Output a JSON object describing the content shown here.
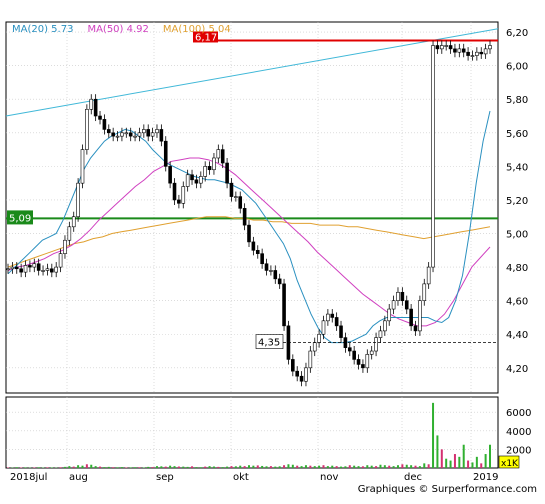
{
  "chart_data": {
    "type": "candlestick",
    "ylim": [
      4.05,
      6.26
    ],
    "y_ticks": [
      "6,20",
      "6,00",
      "5,80",
      "5,60",
      "5,40",
      "5,20",
      "5,00",
      "4,80",
      "4,60",
      "4,40",
      "4,20"
    ],
    "volume_ticks": [
      "6000",
      "4000",
      "2000"
    ],
    "volume_unit": "x1K",
    "x_labels": [
      "2018jul",
      "aug",
      "sep",
      "okt",
      "nov",
      "dec",
      "2019"
    ],
    "legend": [
      {
        "label": "MA(20)",
        "value": "5.73",
        "color": "#2a90c0"
      },
      {
        "label": "MA(50)",
        "value": "4.92",
        "color": "#d040c0"
      },
      {
        "label": "MA(100)",
        "value": "5.04",
        "color": "#e0a030"
      }
    ],
    "resistance": {
      "value": 6.15,
      "label": "6,17",
      "color": "#e00000"
    },
    "support": {
      "value": 5.09,
      "label": "5,09",
      "color": "#1a8a1a"
    },
    "low_marker": {
      "value": 4.35,
      "label": "4,35"
    },
    "trend_line": {
      "color": "#40b8d8",
      "from": 5.7,
      "to": 6.22
    },
    "close": [
      4.79,
      4.8,
      4.79,
      4.77,
      4.81,
      4.8,
      4.82,
      4.78,
      4.78,
      4.79,
      4.77,
      4.8,
      4.88,
      4.96,
      5.04,
      5.1,
      5.3,
      5.5,
      5.74,
      5.8,
      5.7,
      5.68,
      5.62,
      5.6,
      5.58,
      5.58,
      5.6,
      5.6,
      5.58,
      5.58,
      5.6,
      5.62,
      5.58,
      5.6,
      5.62,
      5.55,
      5.4,
      5.3,
      5.2,
      5.18,
      5.28,
      5.35,
      5.32,
      5.3,
      5.34,
      5.4,
      5.38,
      5.45,
      5.5,
      5.42,
      5.3,
      5.22,
      5.22,
      5.15,
      5.05,
      4.95,
      4.9,
      4.88,
      4.82,
      4.78,
      4.78,
      4.73,
      4.7,
      4.45,
      4.25,
      4.18,
      4.15,
      4.12,
      4.2,
      4.3,
      4.35,
      4.4,
      4.48,
      4.52,
      4.5,
      4.45,
      4.38,
      4.32,
      4.3,
      4.25,
      4.22,
      4.2,
      4.28,
      4.3,
      4.38,
      4.42,
      4.48,
      4.55,
      4.6,
      4.65,
      4.6,
      4.55,
      4.45,
      4.42,
      4.6,
      4.7,
      4.8,
      6.12,
      6.1,
      6.12,
      6.12,
      6.1,
      6.08,
      6.1,
      6.08,
      6.06,
      6.06,
      6.08,
      6.07,
      6.1,
      6.12
    ],
    "ma20": [
      4.76,
      4.8,
      4.84,
      4.88,
      4.92,
      4.96,
      4.98,
      5.0,
      5.08,
      5.18,
      5.28,
      5.38,
      5.45,
      5.5,
      5.55,
      5.58,
      5.6,
      5.62,
      5.61,
      5.58,
      5.55,
      5.5,
      5.46,
      5.42,
      5.4,
      5.38,
      5.36,
      5.34,
      5.33,
      5.32,
      5.32,
      5.31,
      5.3,
      5.28,
      5.26,
      5.22,
      5.18,
      5.12,
      5.06,
      5.0,
      4.94,
      4.85,
      4.72,
      4.62,
      4.52,
      4.44,
      4.38,
      4.35,
      4.35,
      4.35,
      4.36,
      4.38,
      4.4,
      4.45,
      4.48,
      4.5,
      4.5,
      4.5,
      4.5,
      4.5,
      4.5,
      4.5,
      4.48,
      4.47,
      4.5,
      4.6,
      4.75,
      5.0,
      5.3,
      5.55,
      5.73
    ],
    "ma50": [
      4.78,
      4.8,
      4.81,
      4.83,
      4.85,
      4.88,
      4.9,
      4.93,
      4.97,
      5.02,
      5.08,
      5.13,
      5.18,
      5.23,
      5.28,
      5.32,
      5.37,
      5.4,
      5.43,
      5.44,
      5.45,
      5.45,
      5.44,
      5.42,
      5.39,
      5.35,
      5.3,
      5.25,
      5.2,
      5.15,
      5.1,
      5.05,
      5.0,
      4.95,
      4.89,
      4.84,
      4.79,
      4.74,
      4.69,
      4.64,
      4.6,
      4.56,
      4.52,
      4.49,
      4.47,
      4.45,
      4.45,
      4.47,
      4.52,
      4.6,
      4.7,
      4.8,
      4.86,
      4.92
    ],
    "ma100": [
      4.8,
      4.82,
      4.84,
      4.86,
      4.88,
      4.9,
      4.92,
      4.94,
      4.95,
      4.97,
      4.98,
      5.0,
      5.01,
      5.02,
      5.03,
      5.04,
      5.05,
      5.06,
      5.07,
      5.08,
      5.09,
      5.1,
      5.1,
      5.1,
      5.09,
      5.09,
      5.08,
      5.08,
      5.07,
      5.07,
      5.06,
      5.06,
      5.06,
      5.05,
      5.05,
      5.05,
      5.04,
      5.04,
      5.03,
      5.02,
      5.01,
      5.0,
      4.99,
      4.98,
      4.97,
      4.98,
      4.99,
      5.0,
      5.01,
      5.02,
      5.03,
      5.04
    ],
    "volume": [
      60,
      40,
      90,
      50,
      70,
      40,
      60,
      80,
      50,
      70,
      60,
      40,
      80,
      120,
      200,
      150,
      300,
      250,
      400,
      350,
      200,
      150,
      100,
      120,
      90,
      80,
      100,
      60,
      70,
      90,
      80,
      60,
      120,
      100,
      200,
      180,
      150,
      250,
      200,
      160,
      150,
      120,
      180,
      100,
      90,
      150,
      200,
      160,
      120,
      100,
      150,
      200,
      180,
      250,
      200,
      300,
      250,
      280,
      220,
      180,
      200,
      150,
      180,
      300,
      400,
      350,
      250,
      200,
      300,
      250,
      200,
      250,
      300,
      200,
      250,
      200,
      150,
      180,
      300,
      250,
      200,
      180,
      300,
      250,
      200,
      350,
      300,
      250,
      200,
      300,
      400,
      350,
      300,
      250,
      200,
      500,
      400,
      7000,
      3500,
      2000,
      1000,
      800,
      1500,
      1200,
      2500,
      800,
      600,
      1200,
      500,
      1500,
      2500
    ]
  },
  "credit": "Graphiques © Surperformance.com"
}
